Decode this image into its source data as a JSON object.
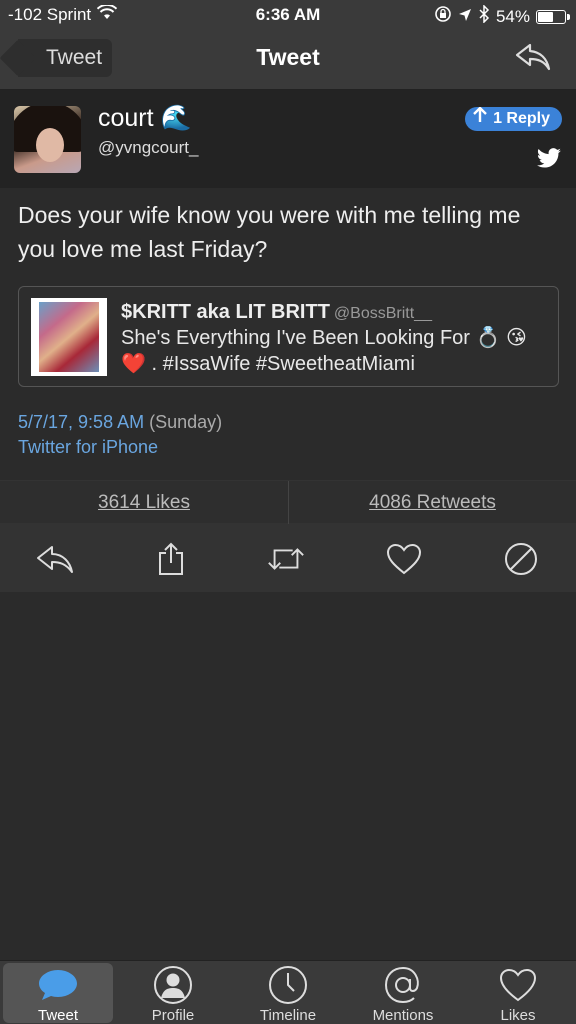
{
  "status_bar": {
    "carrier": "-102 Sprint",
    "time": "6:36 AM",
    "battery": "54%",
    "battery_level": 0.54
  },
  "nav": {
    "back_label": "Tweet",
    "title": "Tweet"
  },
  "tweet": {
    "user_name": "court 🌊",
    "user_handle": "@yvngcourt_",
    "reply_badge": "1 Reply",
    "text": "Does your wife know you were with me telling me you love me last Friday?",
    "quote": {
      "name": "$KRITT aka LIT BRITT",
      "handle": "@BossBritt__",
      "text": "She's Everything I've Been Looking For 💍 😘 ❤️ . #IssaWife #SweetheatMiami"
    },
    "date": "5/7/17, 9:58 AM",
    "day": "(Sunday)",
    "source": "Twitter for iPhone",
    "likes": "3614 Likes",
    "retweets": "4086 Retweets"
  },
  "tabs": [
    {
      "label": "Tweet",
      "icon": "speech-bubble-icon",
      "active": true
    },
    {
      "label": "Profile",
      "icon": "person-icon",
      "active": false
    },
    {
      "label": "Timeline",
      "icon": "clock-icon",
      "active": false
    },
    {
      "label": "Mentions",
      "icon": "at-icon",
      "active": false
    },
    {
      "label": "Likes",
      "icon": "heart-icon",
      "active": false
    }
  ],
  "colors": {
    "accent_blue": "#3b82d8",
    "link_blue": "#6aa6e0",
    "tabbar_active": "#4a9de8"
  }
}
